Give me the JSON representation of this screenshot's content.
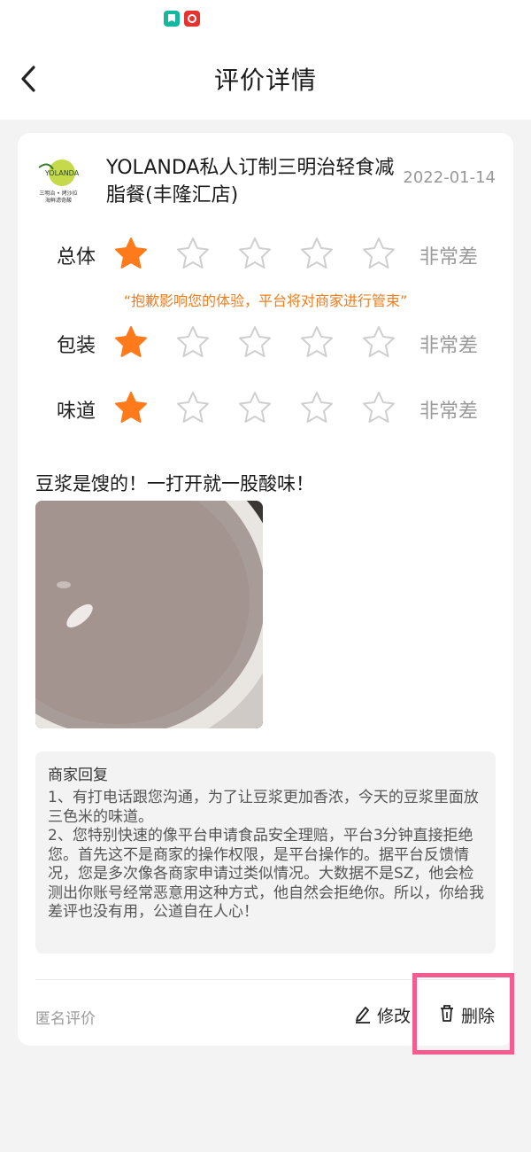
{
  "status_bar": {
    "apps": [
      {
        "name": "green-app-icon",
        "color": "#16b7a0"
      },
      {
        "name": "red-app-icon",
        "color": "#e3342f"
      }
    ]
  },
  "nav": {
    "title": "评价详情",
    "back_icon": "chevron-left-icon"
  },
  "shop": {
    "logo_text_top": "YOLANDA",
    "logo_text_bottom": "三明治 • 烤沙拉\n海鲜滤奇酸",
    "name": "YOLANDA私人订制三明治轻食减脂餐(丰隆汇店)",
    "date": "2022-01-14"
  },
  "ratings": [
    {
      "label": "总体",
      "stars": 1,
      "max": 5,
      "desc": "非常差"
    },
    {
      "label": "包装",
      "stars": 1,
      "max": 5,
      "desc": "非常差"
    },
    {
      "label": "味道",
      "stars": 1,
      "max": 5,
      "desc": "非常差"
    }
  ],
  "apology": "“抱歉影响您的体验，平台将对商家进行管束”",
  "review": {
    "text": "豆浆是馊的！一打开就一股酸味！"
  },
  "merchant_reply": {
    "title": "商家回复",
    "body": "1、有打电话跟您沟通，为了让豆浆更加香浓，今天的豆浆里面放三色米的味道。\n2、您特别快速的像平台申请食品安全理赔，平台3分钟直接拒绝您。首先这不是商家的操作权限，是平台操作的。据平台反馈情况，您是多次像各商家申请过类似情况。大数据不是SZ，他会检测出你账号经常恶意用这种方式，他自然会拒绝你。所以，你给我差评也没有用，公道自在人心！"
  },
  "footer": {
    "anonymous": "匿名评价",
    "edit_label": "修改",
    "delete_label": "删除",
    "edit_icon": "pencil-icon",
    "delete_icon": "trash-icon"
  },
  "colors": {
    "star_active": "#ff7a1a",
    "star_inactive": "#cfcfcf",
    "apology": "#f07c1c",
    "highlight": "#f45b8f"
  }
}
